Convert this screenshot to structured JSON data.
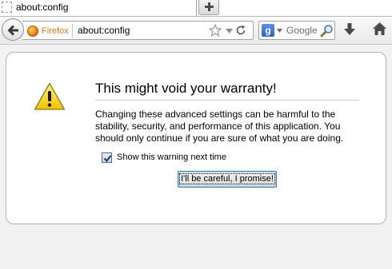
{
  "tab": {
    "title": "about:config",
    "new_tab_glyph": "+"
  },
  "navbar": {
    "identity_label": "Firefox",
    "url": "about:config",
    "search_engine_letter": "g",
    "search_placeholder": "Google",
    "icons": [
      "back-icon",
      "firefox-logo-icon",
      "bookmark-star-icon",
      "dropmarker-icon",
      "reload-icon",
      "search-engine-icon",
      "magnifier-icon",
      "download-icon",
      "home-icon"
    ]
  },
  "warning": {
    "title": "This might void your warranty!",
    "message": "Changing these advanced settings can be harmful to the stability, security, and performance of this application. You should only continue if you are sure of what you are doing.",
    "checkbox_label": "Show this warning next time",
    "checkbox_checked": true,
    "button_label": "I'll be careful, I promise!"
  },
  "colors": {
    "warning_icon": "#f5d100",
    "identity_label": "#e07a1a",
    "button_focus_border": "#3c7fb1"
  }
}
